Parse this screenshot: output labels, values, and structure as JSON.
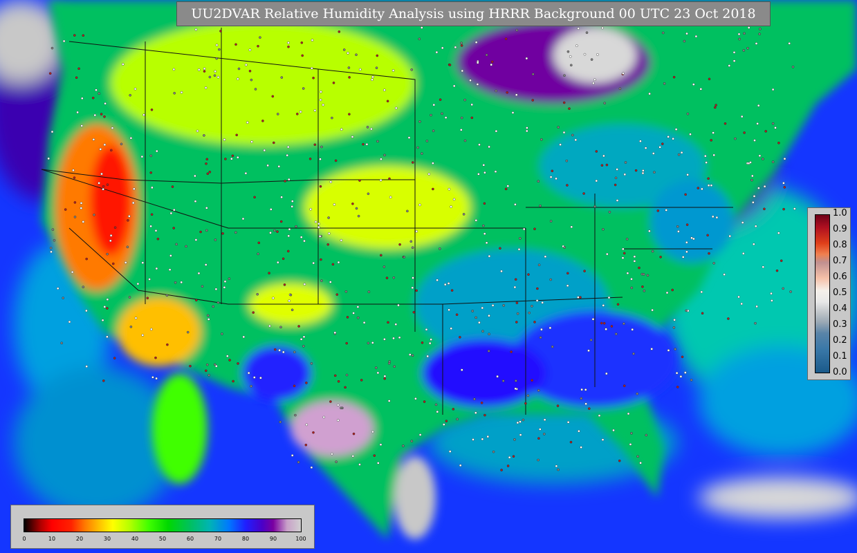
{
  "title": "UU2DVAR Relative Humidity Analysis using HRRR Background 00 UTC 23 Oct 2018",
  "colorbar_bottom": {
    "ticks": [
      "0",
      "10",
      "20",
      "30",
      "40",
      "50",
      "60",
      "70",
      "80",
      "90",
      "100"
    ]
  },
  "colorbar_right": {
    "ticks": [
      "1.0",
      "0.9",
      "0.8",
      "0.7",
      "0.6",
      "0.5",
      "0.4",
      "0.3",
      "0.2",
      "0.1",
      "0.0"
    ]
  },
  "colors": {
    "ocean": "#1a4cff",
    "land_humid": "#00c060",
    "land_dry": "#ff2200",
    "station_marker": "#ffffff"
  }
}
